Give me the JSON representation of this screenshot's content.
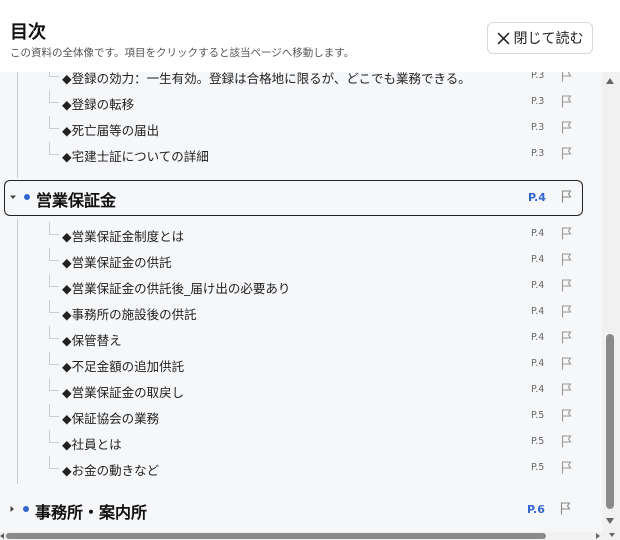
{
  "header": {
    "title": "目次",
    "subtitle": "この資料の全体像です。項目をクリックすると該当ページへ移動します。",
    "close_label": "閉じて読む"
  },
  "toc": {
    "prev_items": [
      {
        "label": "◆登録の効力：一生有効。登録は合格地に限るが、どこでも業務できる。",
        "page": "P.3"
      },
      {
        "label": "◆登録の転移",
        "page": "P.3"
      },
      {
        "label": "◆死亡届等の届出",
        "page": "P.3"
      },
      {
        "label": "◆宅建士証についての詳細",
        "page": "P.3"
      }
    ],
    "active_section": {
      "label": "営業保証金",
      "page": "P.4"
    },
    "active_items": [
      {
        "label": "◆営業保証金制度とは",
        "page": "P.4"
      },
      {
        "label": "◆営業保証金の供託",
        "page": "P.4"
      },
      {
        "label": "◆営業保証金の供託後_届け出の必要あり",
        "page": "P.4"
      },
      {
        "label": "◆事務所の施設後の供託",
        "page": "P.4"
      },
      {
        "label": "◆保管替え",
        "page": "P.4"
      },
      {
        "label": "◆不足金額の追加供託",
        "page": "P.4"
      },
      {
        "label": "◆営業保証金の取戻し",
        "page": "P.4"
      },
      {
        "label": "◆保証協会の業務",
        "page": "P.5"
      },
      {
        "label": "◆社員とは",
        "page": "P.5"
      },
      {
        "label": "◆お金の動きなど",
        "page": "P.5"
      }
    ],
    "next_section": {
      "label": "事務所・案内所",
      "page": "P.6"
    }
  },
  "colors": {
    "accent": "#3366cc",
    "panel_bg": "#f6f7f9",
    "active_border": "#222222"
  },
  "icons": {
    "close": "close-icon",
    "flag": "bookmark-flag-icon",
    "caret": "caret-right-icon",
    "dot": "section-dot-icon"
  }
}
